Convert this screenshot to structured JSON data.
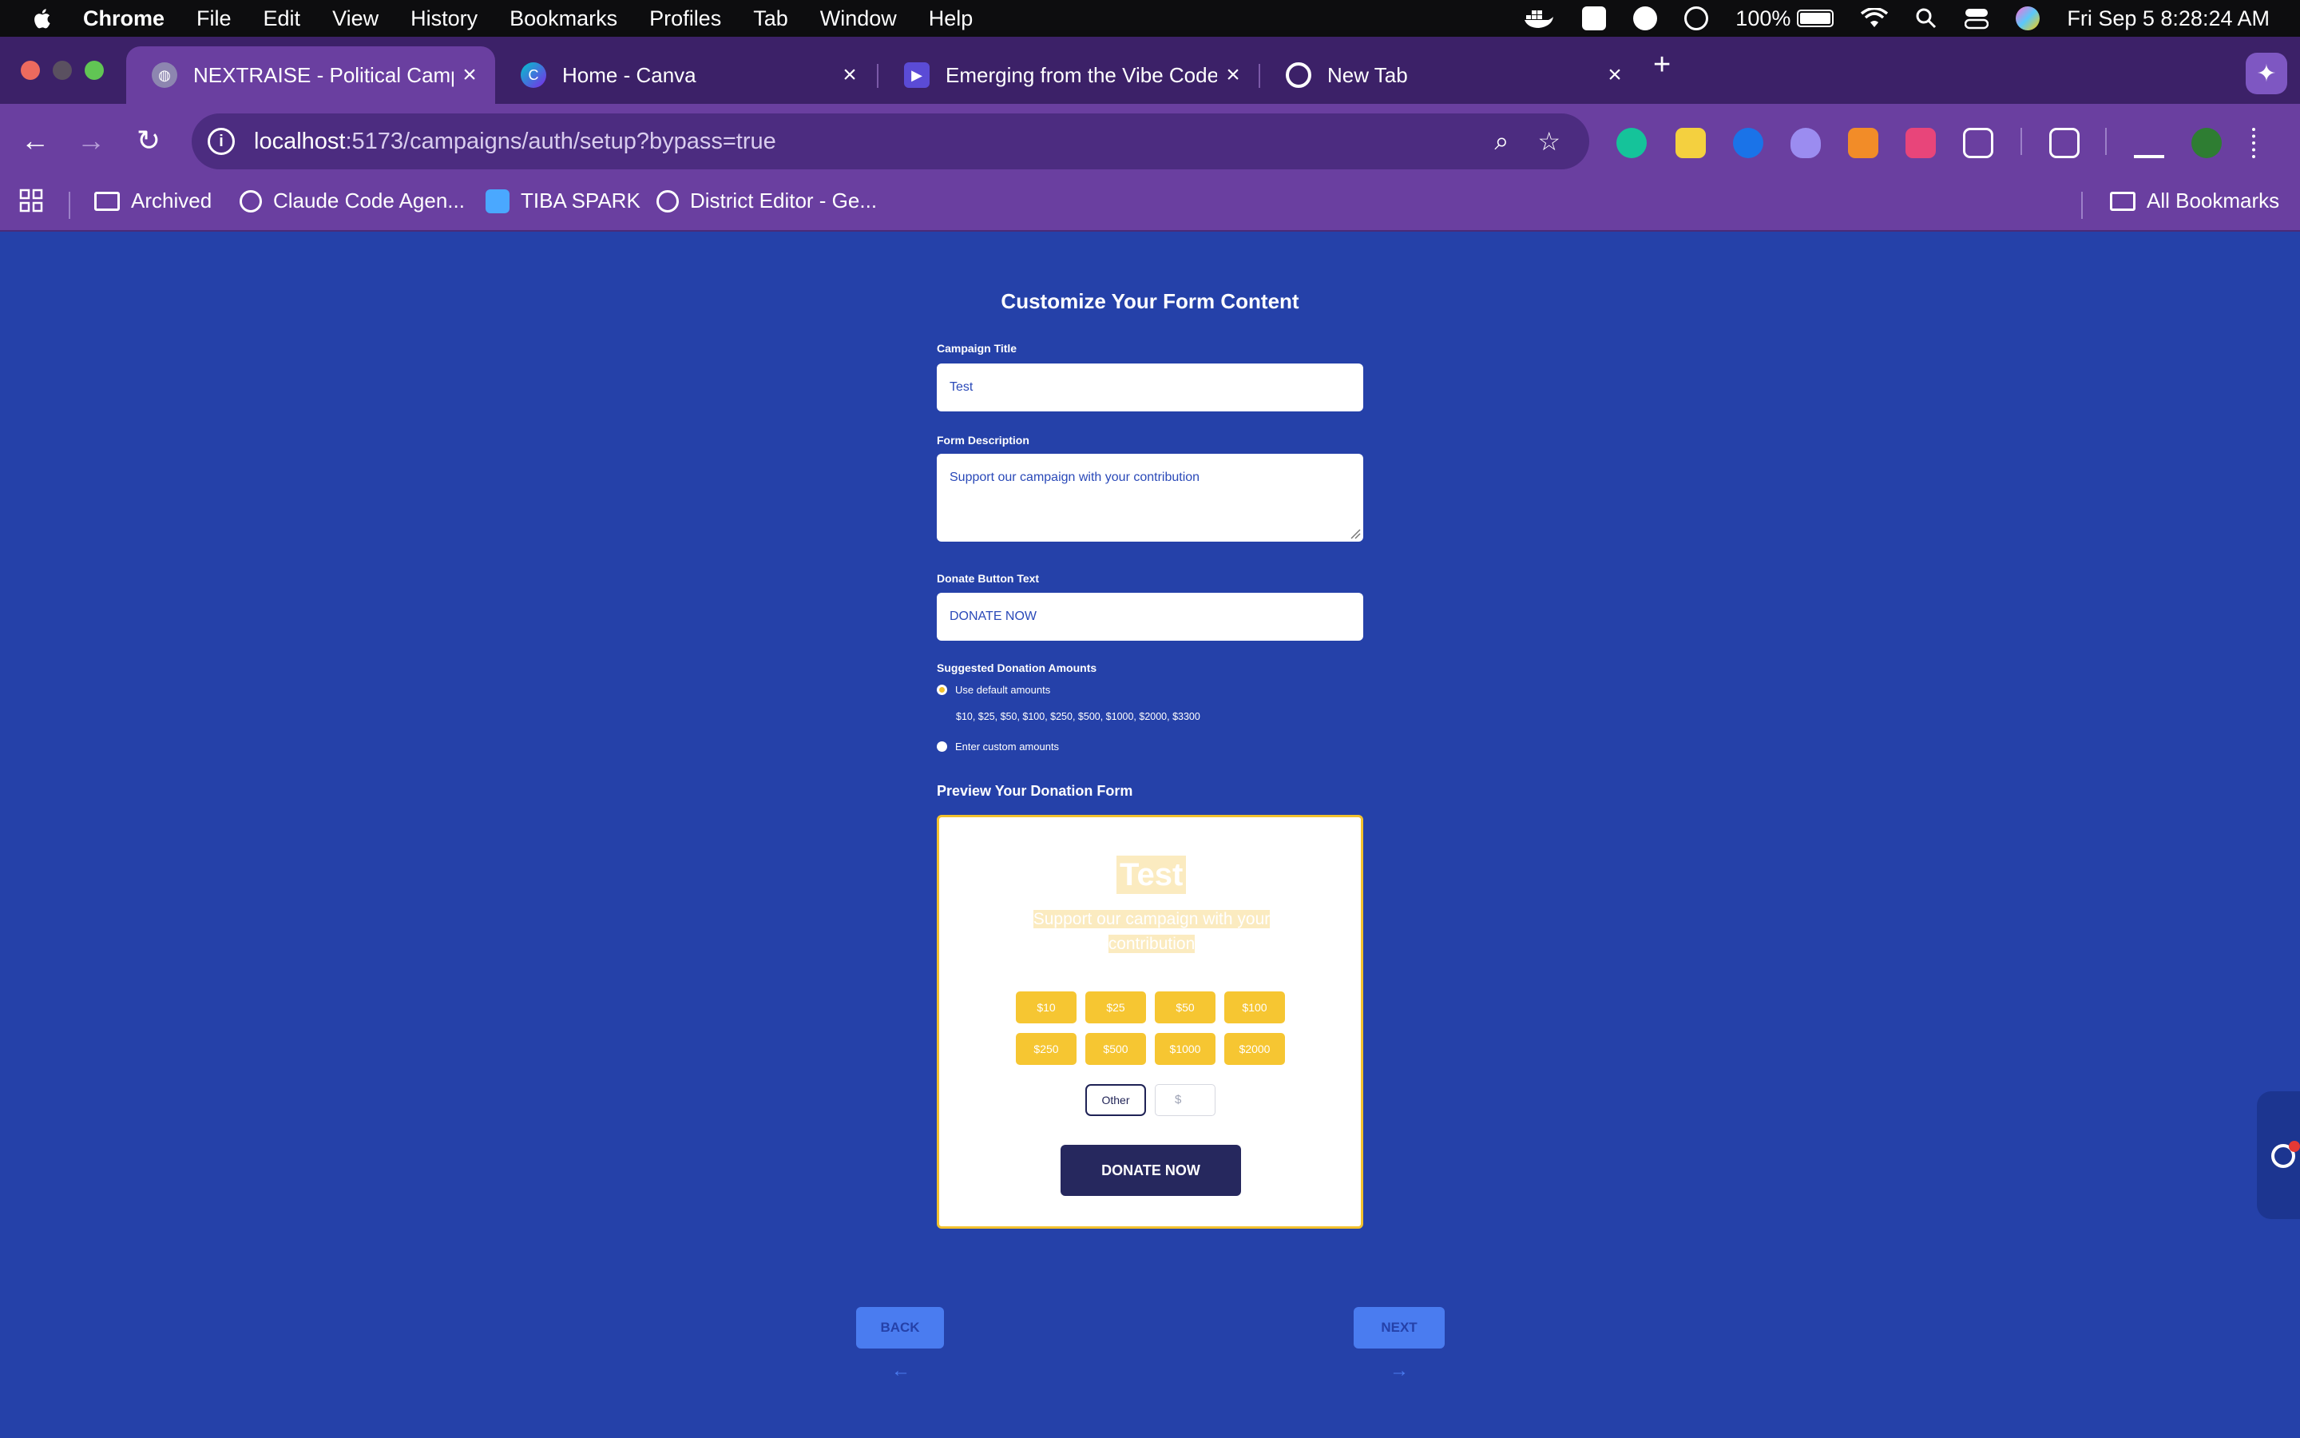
{
  "menubar": {
    "app": "Chrome",
    "items": [
      "File",
      "Edit",
      "View",
      "History",
      "Bookmarks",
      "Profiles",
      "Tab",
      "Window",
      "Help"
    ],
    "battery": "100%",
    "datetime": "Fri Sep 5  8:28:24 AM"
  },
  "tabs": [
    {
      "title": "NEXTRAISE - Political Campa",
      "favicon": "globe-icon",
      "active": true
    },
    {
      "title": "Home - Canva",
      "favicon": "canva-icon",
      "active": false
    },
    {
      "title": "Emerging from the Vibe Code",
      "favicon": "video-icon",
      "active": false
    },
    {
      "title": "New Tab",
      "favicon": "chrome-icon",
      "active": false
    }
  ],
  "address_bar": {
    "host": "localhost",
    "path": ":5173/campaigns/auth/setup?bypass=true"
  },
  "bookmarks": {
    "items": [
      "Archived",
      "Claude Code Agen...",
      "TIBA SPARK",
      "District Editor - Ge..."
    ],
    "all": "All Bookmarks"
  },
  "form": {
    "heading": "Customize Your Form Content",
    "campaign_title_label": "Campaign Title",
    "campaign_title_value": "Test",
    "description_label": "Form Description",
    "description_value": "Support our campaign with your contribution",
    "button_text_label": "Donate Button Text",
    "button_text_value": "DONATE NOW",
    "amounts_label": "Suggested Donation Amounts",
    "option_default": "Use default amounts",
    "default_amounts": "$10, $25, $50, $100, $250, $500, $1000, $2000, $3300",
    "option_custom": "Enter custom amounts",
    "selected_option": "default"
  },
  "preview": {
    "heading": "Preview Your Donation Form",
    "title": "Test",
    "description": "Support our campaign with your contribution",
    "amounts": [
      "$10",
      "$25",
      "$50",
      "$100",
      "$250",
      "$500",
      "$1000",
      "$2000"
    ],
    "other_label": "Other",
    "other_placeholder": "$",
    "donate_label": "DONATE NOW"
  },
  "navigation": {
    "back": "BACK",
    "next": "NEXT"
  },
  "colors": {
    "page_bg": "#2541a9",
    "accent_yellow": "#f6c632",
    "donate_navy": "#26285e",
    "nav_button": "#4a7cf0",
    "browser_purple": "#6a3fa0"
  }
}
